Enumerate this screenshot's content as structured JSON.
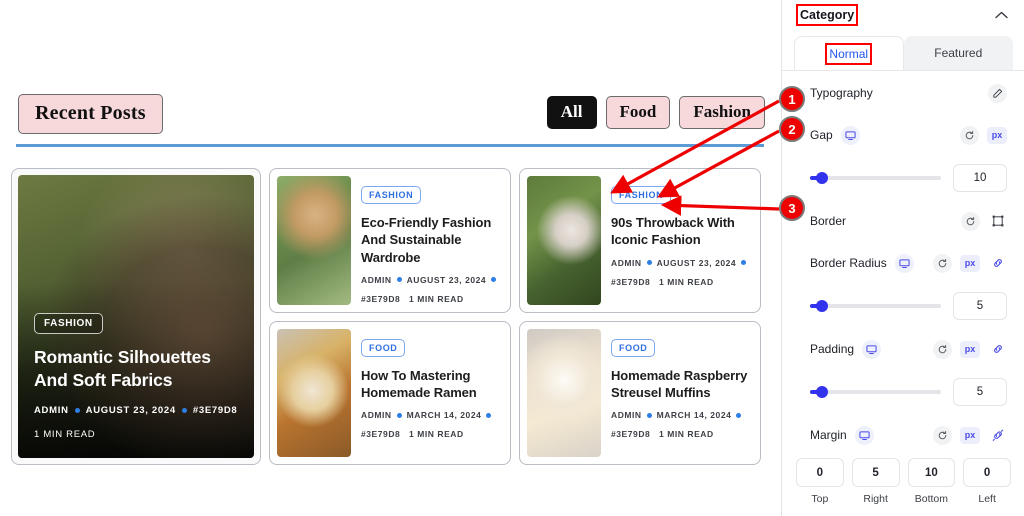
{
  "preview": {
    "section_label": "Recent Posts",
    "filters": [
      {
        "label": "All",
        "active": true
      },
      {
        "label": "Food",
        "active": false
      },
      {
        "label": "Fashion",
        "active": false
      }
    ],
    "featured": {
      "category": "FASHION",
      "title": "Romantic Silhouettes And Soft Fabrics",
      "author": "ADMIN",
      "date": "AUGUST 23, 2024",
      "color_code": "#3E79D8",
      "read_time": "1 MIN READ",
      "image_alt": "woman-sunglasses-photo"
    },
    "posts": [
      {
        "category": "FASHION",
        "title": "Eco-Friendly Fashion And Sustainable Wardrobe",
        "author": "ADMIN",
        "date": "AUGUST 23, 2024",
        "color_code": "#3E79D8",
        "read_time": "1 MIN READ",
        "image_alt": "woman-straw-hat-photo"
      },
      {
        "category": "FASHION",
        "title": "90s Throwback With Iconic Fashion",
        "author": "ADMIN",
        "date": "AUGUST 23, 2024",
        "color_code": "#3E79D8",
        "read_time": "1 MIN READ",
        "image_alt": "woman-white-dress-flowers-photo"
      },
      {
        "category": "FOOD",
        "title": "How To Mastering Homemade Ramen",
        "author": "ADMIN",
        "date": "MARCH 14, 2024",
        "color_code": "#3E79D8",
        "read_time": "1 MIN READ",
        "image_alt": "ramen-bowl-photo"
      },
      {
        "category": "FOOD",
        "title": "Homemade Raspberry Streusel Muffins",
        "author": "ADMIN",
        "date": "MARCH 14, 2024",
        "color_code": "#3E79D8",
        "read_time": "1 MIN READ",
        "image_alt": "raspberry-muffins-photo"
      }
    ]
  },
  "panel": {
    "title": "Category",
    "collapse_icon": "chevron-up-icon",
    "tabs": [
      {
        "label": "Normal",
        "active": true
      },
      {
        "label": "Featured",
        "active": false
      }
    ],
    "controls": {
      "typography": {
        "label": "Typography",
        "edit_icon": "pencil-icon"
      },
      "gap": {
        "label": "Gap",
        "device_icon": "monitor-icon",
        "reset_icon": "reset-icon",
        "unit": "px",
        "value": "10"
      },
      "border": {
        "label": "Border",
        "reset_icon": "reset-icon",
        "border_icon": "border-square-icon"
      },
      "border_radius": {
        "label": "Border Radius",
        "device_icon": "monitor-icon",
        "reset_icon": "reset-icon",
        "unit": "px",
        "link_icon": "link-icon",
        "value": "5"
      },
      "padding": {
        "label": "Padding",
        "device_icon": "monitor-icon",
        "reset_icon": "reset-icon",
        "unit": "px",
        "link_icon": "link-icon",
        "value": "5"
      },
      "margin": {
        "label": "Margin",
        "device_icon": "monitor-icon",
        "reset_icon": "reset-icon",
        "unit": "px",
        "link_icon": "unlink-icon",
        "fields": [
          {
            "value": "0",
            "label": "Top"
          },
          {
            "value": "5",
            "label": "Right"
          },
          {
            "value": "10",
            "label": "Bottom"
          },
          {
            "value": "0",
            "label": "Left"
          }
        ]
      }
    }
  },
  "annotations": {
    "accent_color": "#EE0000",
    "markers": [
      {
        "number": "1"
      },
      {
        "number": "2"
      },
      {
        "number": "3"
      }
    ],
    "highlight_boxes": [
      "Category",
      "Normal"
    ]
  }
}
